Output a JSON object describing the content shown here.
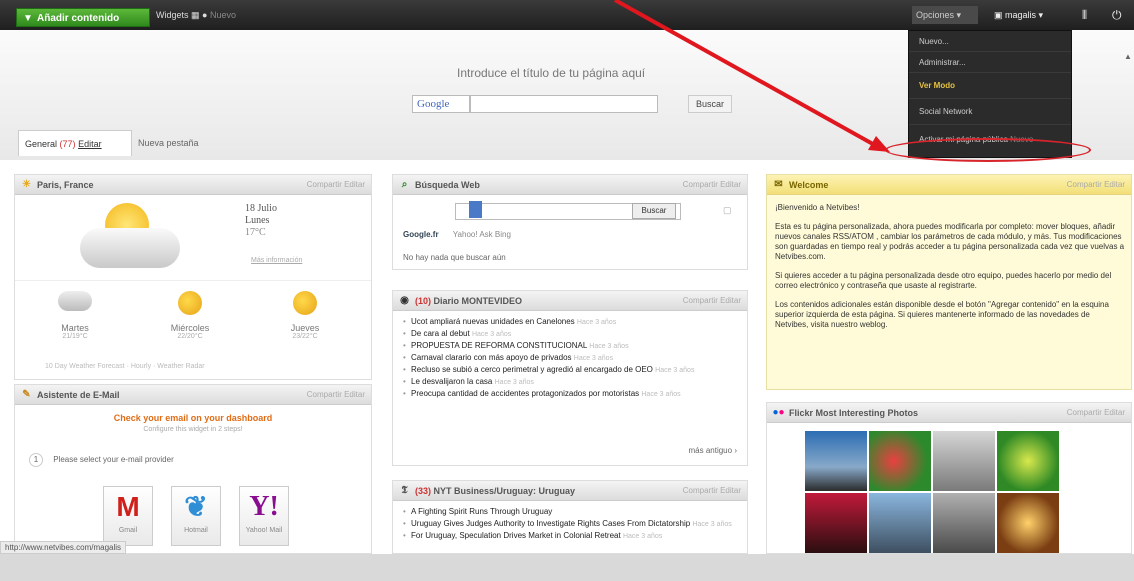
{
  "topbar": {
    "add_button": "Añadir contenido",
    "widgets_label": "Widgets",
    "widgets_extra": "Nuevo",
    "options_label": "Opciones",
    "user_label": "magalis"
  },
  "header": {
    "page_title": "Introduce el título de tu página aquí",
    "google_label": "Google",
    "search_button": "Buscar"
  },
  "tabs": {
    "active_name": "General",
    "active_count": "(77)",
    "edit_label": "Editar",
    "new_tab": "Nueva pestaña"
  },
  "dropdown": {
    "items": [
      {
        "label": "Nuevo..."
      },
      {
        "label": "Administrar..."
      },
      {
        "label": "Ver Modo"
      },
      {
        "label": "Social Network"
      },
      {
        "label": "Activar mi página pública",
        "note": "Nuevo"
      }
    ]
  },
  "weather": {
    "title": "Paris, France",
    "controls": "Compartir  Editar",
    "date": "18 Julio",
    "weekday": "Lunes",
    "temp": "17°C",
    "link": "Más información",
    "days": [
      {
        "name": "Martes",
        "temp": "21/19°C"
      },
      {
        "name": "Miércoles",
        "temp": "22/20°C"
      },
      {
        "name": "Jueves",
        "temp": "23/22°C"
      }
    ],
    "footer": "10 Day Weather Forecast · Hourly · Weather Radar"
  },
  "email": {
    "title": "Asistente de E-Mail",
    "controls": "Compartir  Editar",
    "headline": "Check your email on your dashboard",
    "sub": "Configure this widget in 2 steps!",
    "step_num": "1",
    "step_text": "Please select your e-mail provider",
    "providers": [
      "Gmail",
      "Hotmail",
      "Yahoo! Mail"
    ]
  },
  "websearch": {
    "title": "Búsqueda Web",
    "controls": "Compartir  Editar",
    "search_button": "Buscar",
    "tabs_google": "Google.fr",
    "tabs_rest": "Yahoo!   Ask   Bing",
    "empty_text": "No hay nada que buscar aún"
  },
  "news1": {
    "title": "Diario MONTEVIDEO",
    "count": "(10)",
    "controls": "Compartir  Editar",
    "items": [
      {
        "text": "Ucot ampliará nuevas unidades en Canelones",
        "ago": "Hace 3 años"
      },
      {
        "text": "De cara al debut",
        "ago": "Hace 3 años"
      },
      {
        "text": "PROPUESTA DE REFORMA CONSTITUCIONAL",
        "ago": "Hace 3 años"
      },
      {
        "text": "Carnaval clarario con más apoyo de privados",
        "ago": "Hace 3 años"
      },
      {
        "text": "Recluso se subió a cerco perimetral y agredió al encargado de OEO",
        "ago": "Hace 3 años"
      },
      {
        "text": "Le desvalijaron la casa",
        "ago": "Hace 3 años"
      },
      {
        "text": "Preocupa cantidad de accidentes protagonizados por motoristas",
        "ago": "Hace 3 años"
      }
    ],
    "more": "más antiguo"
  },
  "news2": {
    "title": "NYT Business/Uruguay: Uruguay",
    "count": "(33)",
    "controls": "Compartir  Editar",
    "items": [
      {
        "text": "A Fighting Spirit Runs Through Uruguay",
        "ago": ""
      },
      {
        "text": "Uruguay Gives Judges Authority to Investigate Rights Cases From Dictatorship",
        "ago": "Hace 3 años"
      },
      {
        "text": "For Uruguay, Speculation Drives Market in Colonial Retreat",
        "ago": "Hace 3 años"
      }
    ]
  },
  "welcome": {
    "title": "Welcome",
    "controls": "Compartir  Editar",
    "p1": "¡Bienvenido a Netvibes!",
    "p2": "Esta es tu página personalizada, ahora puedes modificarla por completo: mover bloques, añadir nuevos canales RSS/ATOM , cambiar los parámetros de cada módulo, y más. Tus modificaciones son guardadas en tiempo real y podrás acceder a tu página personalizada cada vez que vuelvas a Netvibes.com.",
    "p3": "Si quieres acceder a tu página personalizada desde otro equipo, puedes hacerlo por medio del correo electrónico y contraseña que usaste al registrarte.",
    "p4": "Los contenidos adicionales están disponible desde el botón \"Agregar contenido\" en la esquina superior izquierda de esta página. Si quieres mantenerte informado de las novedades de Netvibes, visita nuestro weblog."
  },
  "flickr": {
    "title": "Flickr Most Interesting Photos",
    "controls": "Compartir  Editar"
  },
  "status_url": "http://www.netvibes.com/magalis",
  "colors": {
    "accent_green": "#3da12a",
    "highlight_red": "#d8242b",
    "welcome_yellow": "#fffbd8"
  }
}
